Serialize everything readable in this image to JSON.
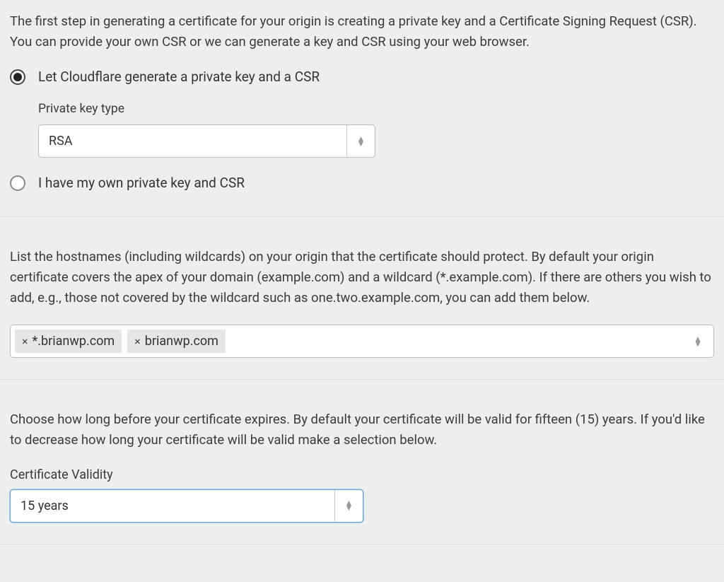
{
  "step1": {
    "description": "The first step in generating a certificate for your origin is creating a private key and a Certificate Signing Request (CSR). You can provide your own CSR or we can generate a key and CSR using your web browser.",
    "option_generate": "Let Cloudflare generate a private key and a CSR",
    "option_own": "I have my own private key and CSR",
    "private_key_label": "Private key type",
    "private_key_value": "RSA"
  },
  "step2": {
    "description": "List the hostnames (including wildcards) on your origin that the certificate should protect. By default your origin certificate covers the apex of your domain (example.com) and a wildcard (*.example.com). If there are others you wish to add, e.g., those not covered by the wildcard such as one.two.example.com, you can add them below.",
    "hostnames": [
      "*.brianwp.com",
      "brianwp.com"
    ]
  },
  "step3": {
    "description": "Choose how long before your certificate expires. By default your certificate will be valid for fifteen (15) years. If you'd like to decrease how long your certificate will be valid make a selection below.",
    "validity_label": "Certificate Validity",
    "validity_value": "15 years"
  }
}
